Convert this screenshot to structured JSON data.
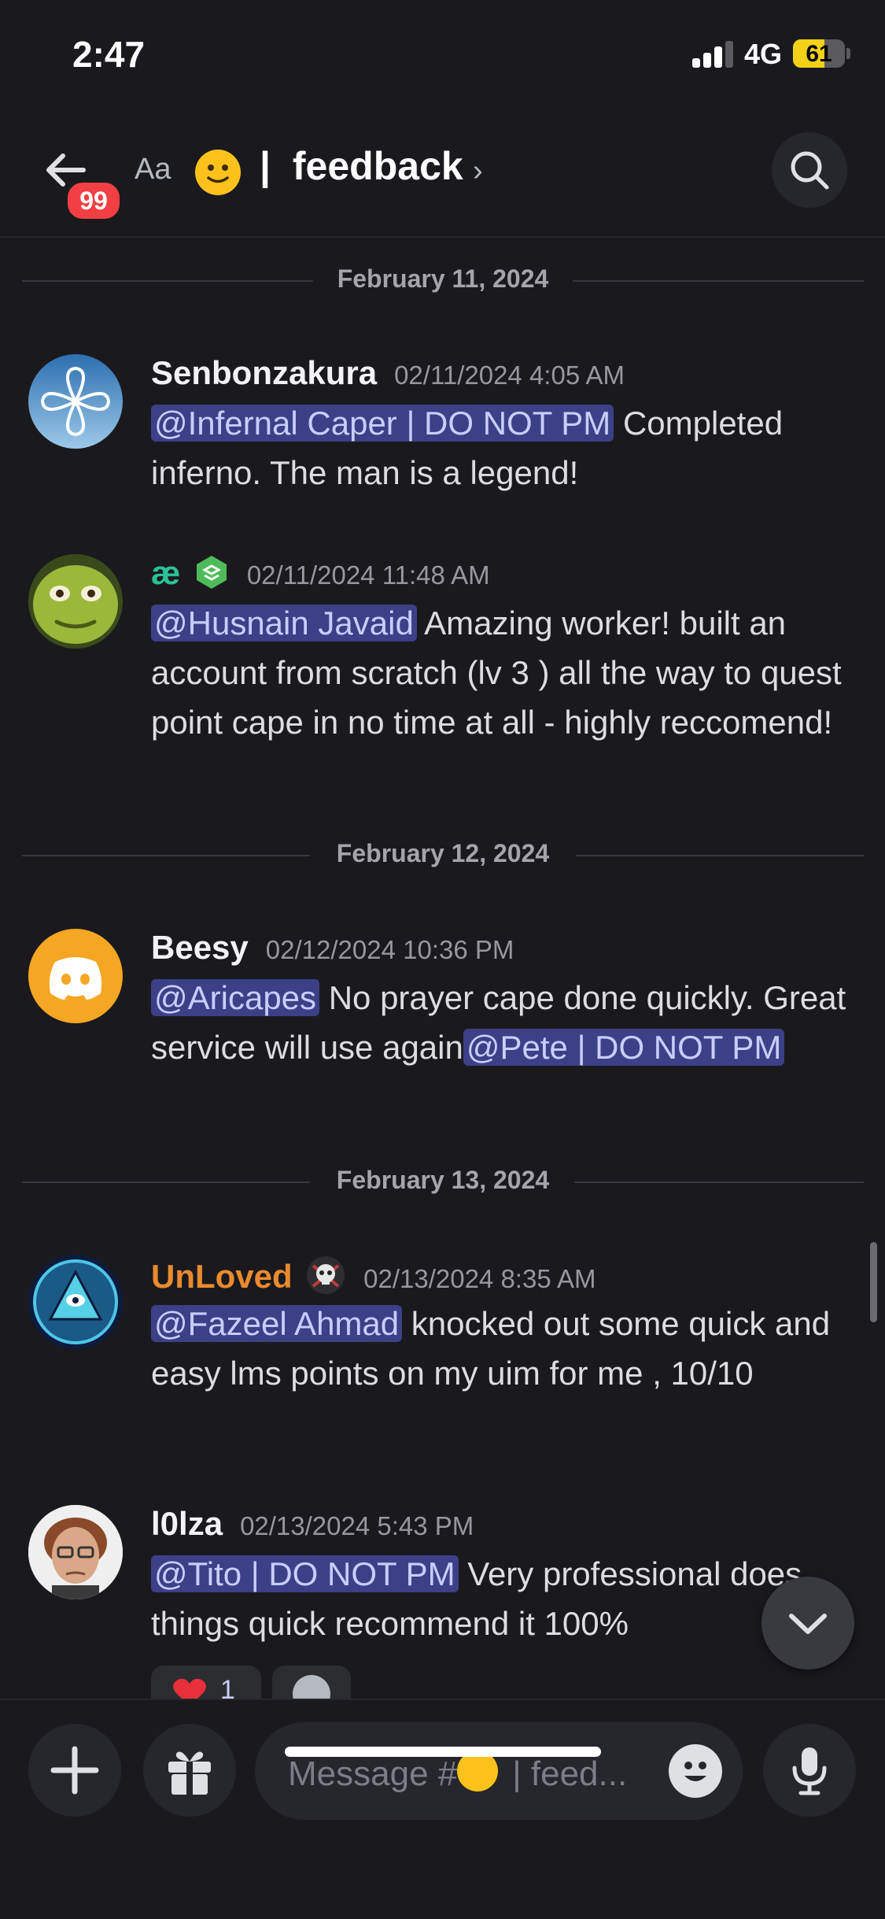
{
  "status_bar": {
    "time": "2:47",
    "network": "4G",
    "battery": "61",
    "battery_level": 0.61
  },
  "header": {
    "unread_badge": "99",
    "text_size_label": "Aa",
    "channel_separator": "|",
    "channel_name": "feedback",
    "chevron": "›"
  },
  "dates": [
    "February 11, 2024",
    "February 12, 2024",
    "February 13, 2024"
  ],
  "messages": [
    {
      "author": "Senbonzakura",
      "timestamp": "02/11/2024 4:05 AM",
      "mention": "@Infernal Caper | DO NOT PM",
      "text": " Completed inferno. The man is a legend!"
    },
    {
      "author": "æ",
      "timestamp": "02/11/2024 11:48 AM",
      "mention": "@Husnain Javaid",
      "text": " Amazing worker! built an account from scratch (lv 3 ) all the way to quest point cape in no time at all - highly reccomend!"
    },
    {
      "author": "Beesy",
      "timestamp": "02/12/2024 10:36 PM",
      "mention": "@Aricapes",
      "text": " No prayer cape done quickly. Great service will use again",
      "mention2": "@Pete | DO NOT PM"
    },
    {
      "author": "UnLoved",
      "timestamp": "02/13/2024 8:35 AM",
      "mention": "@Fazeel Ahmad",
      "text": " knocked out some quick and easy lms points on my uim for me , 10/10"
    },
    {
      "author": "l0lza",
      "timestamp": "02/13/2024 5:43 PM",
      "mention": "@Tito | DO NOT PM",
      "text": " Very professional does things quick recommend it 100%",
      "reaction_count": "1"
    }
  ],
  "composer": {
    "placeholder_prefix": "Message #",
    "placeholder_suffix": "| feed..."
  },
  "colors": {
    "background": "#1a1a1e",
    "mention_bg": "#3c4087",
    "mention_text": "#c9cdfb",
    "orange_name": "#e98a2e",
    "teal_name": "#2dbf95",
    "badge_red": "#f23f43"
  },
  "icons": [
    "back-arrow-icon",
    "smiley-emoji-icon",
    "search-icon",
    "discord-logo-icon",
    "server-tag-icon",
    "skull-badge-icon",
    "heart-emoji-icon",
    "add-reaction-icon",
    "chevron-down-icon",
    "plus-icon",
    "gift-icon",
    "emoji-icon",
    "microphone-icon"
  ]
}
